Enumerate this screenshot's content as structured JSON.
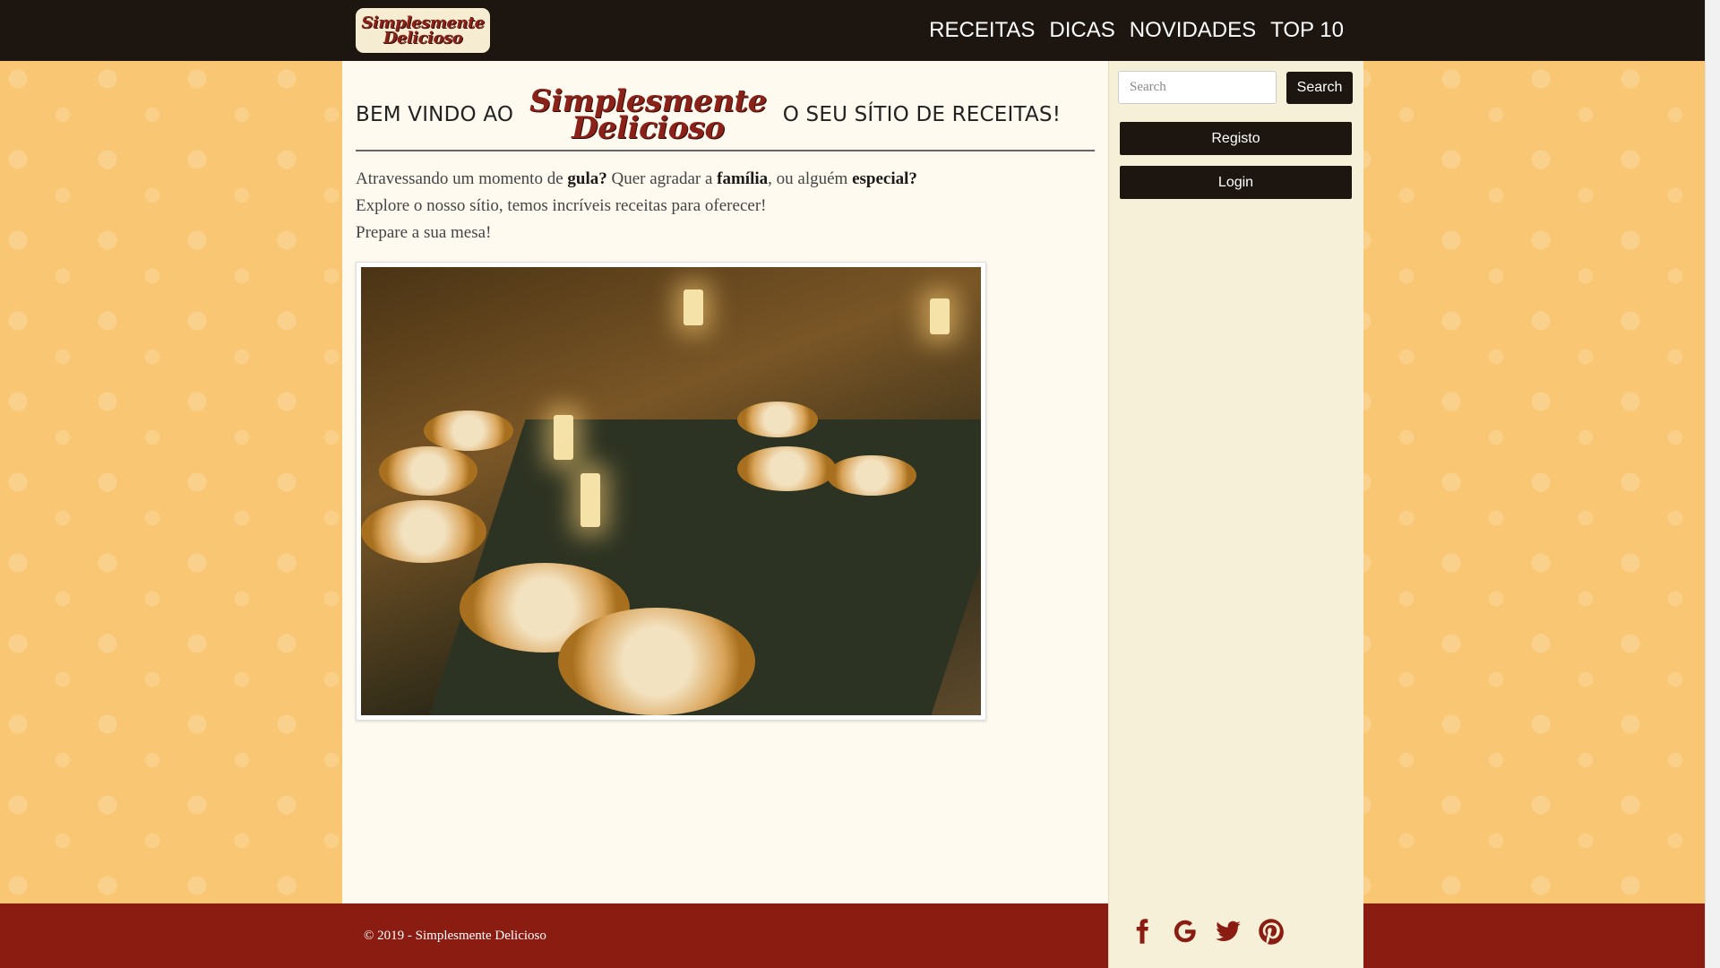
{
  "navbar": {
    "logo_line1": "Simplesmente",
    "logo_line2": "Delicioso",
    "links": [
      "RECEITAS",
      "DICAS",
      "NOVIDADES",
      "TOP 10"
    ]
  },
  "main": {
    "welcome_prefix": "BEM VINDO AO",
    "welcome_suffix": "O SEU SÍTIO DE RECEITAS!",
    "intro": {
      "line1_a": "Atravessando um momento de ",
      "line1_gula": "gula?",
      "line1_b": " Quer agradar a ",
      "line1_familia": "família",
      "line1_c": ", ou alguém ",
      "line1_especial": "especial?",
      "line2": "Explore o nosso sítio, temos incríveis receitas para oferecer!",
      "line3": "Prepare a sua mesa!"
    }
  },
  "sidebar": {
    "search_placeholder": "Search",
    "search_button": "Search",
    "register_button": "Registo",
    "login_button": "Login"
  },
  "footer": {
    "copyright": "© 2019 - Simplesmente Delicioso"
  },
  "social": {
    "icons": [
      "facebook-icon",
      "google-icon",
      "twitter-icon",
      "pinterest-icon"
    ],
    "color": "#8a1c12"
  },
  "colors": {
    "navbar": "#1d1610",
    "background": "#f9c773",
    "footer": "#8a1c12",
    "content": "#fefaf0",
    "sidebar": "#f6f0d8"
  }
}
